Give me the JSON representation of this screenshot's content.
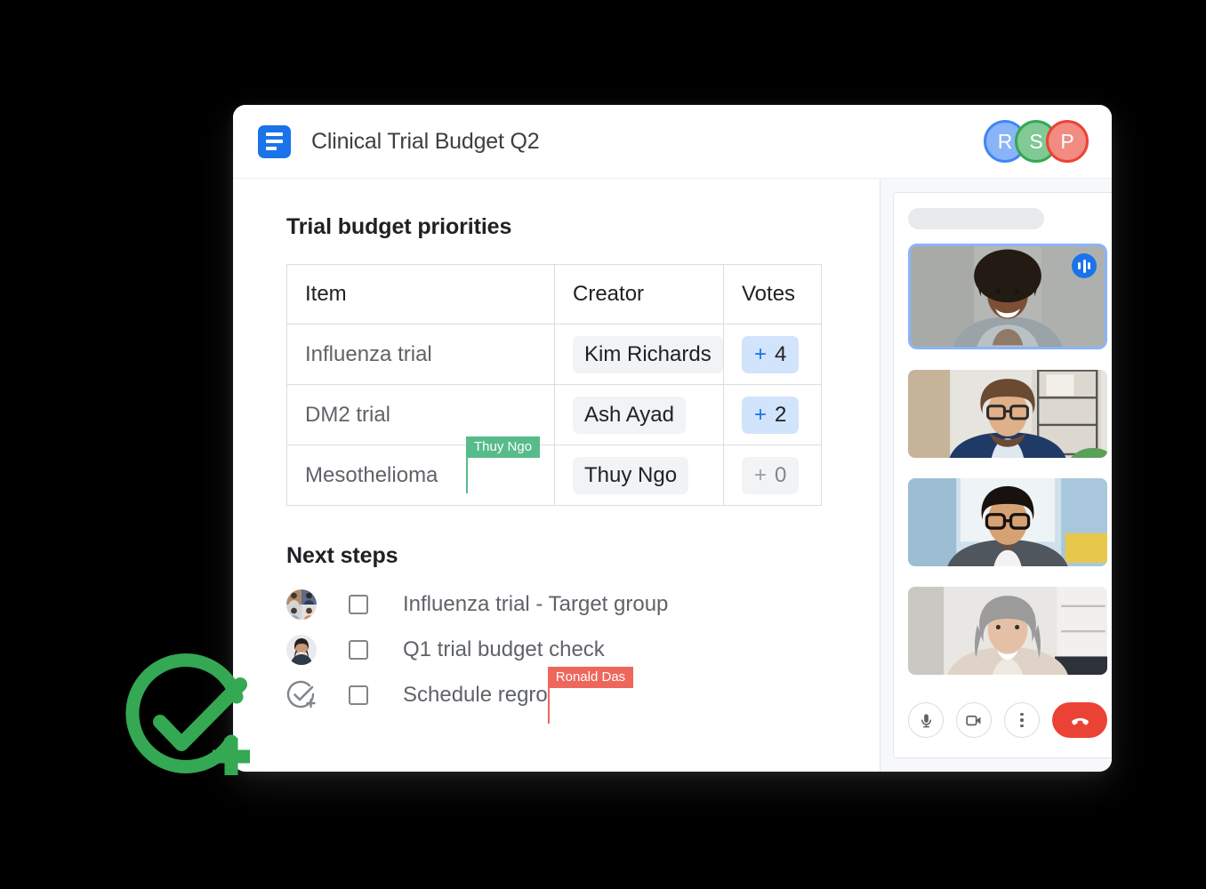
{
  "window": {
    "header": {
      "doc_icon": "document-icon",
      "title": "Clinical Trial Budget Q2",
      "avatars": [
        {
          "initial": "R",
          "color": "#8ab4f8",
          "ring": "#4285f4"
        },
        {
          "initial": "S",
          "color": "#81c995",
          "ring": "#34a853"
        },
        {
          "initial": "P",
          "color": "#f28b82",
          "ring": "#ea4335"
        }
      ]
    },
    "document": {
      "section_title": "Trial budget priorities",
      "table": {
        "headers": [
          "Item",
          "Creator",
          "Votes"
        ],
        "rows": [
          {
            "item": "Influenza trial",
            "creator": "Kim Richards",
            "vote_plus": "+",
            "votes": "4",
            "vote_state": "active"
          },
          {
            "item": "DM2 trial",
            "creator": "Ash Ayad",
            "vote_plus": "+",
            "votes": "2",
            "vote_state": "active"
          },
          {
            "item": "Mesothelioma",
            "creator": "Thuy Ngo",
            "vote_plus": "+",
            "votes": "0",
            "vote_state": "zero"
          }
        ]
      },
      "cursors": [
        {
          "name": "Thuy Ngo",
          "color": "#57bb8a"
        },
        {
          "name": "Ronald Das",
          "color": "#ee675c"
        }
      ],
      "next_steps_title": "Next steps",
      "next_steps": [
        {
          "label": "Influenza trial - Target group",
          "avatar": "group-avatar",
          "checked": false
        },
        {
          "label": "Q1 trial budget check",
          "avatar": "person-avatar",
          "checked": false
        },
        {
          "label": "Schedule regro",
          "avatar": "assign-task-icon",
          "checked": false
        }
      ]
    },
    "call_panel": {
      "participants": [
        {
          "name": "participant-1",
          "speaking": true,
          "badge": "audio-wave-icon"
        },
        {
          "name": "participant-2",
          "speaking": false
        },
        {
          "name": "participant-3",
          "speaking": false
        },
        {
          "name": "participant-4",
          "speaking": false
        }
      ],
      "controls": [
        {
          "name": "microphone-button",
          "icon": "microphone-icon"
        },
        {
          "name": "camera-button",
          "icon": "video-camera-icon"
        },
        {
          "name": "more-options-button",
          "icon": "kebab-menu-icon"
        },
        {
          "name": "end-call-button",
          "icon": "phone-hangup-icon",
          "color": "#ea4335"
        }
      ]
    }
  },
  "brand": {
    "logo": "circle-check-plus-icon",
    "color": "#34a853"
  }
}
